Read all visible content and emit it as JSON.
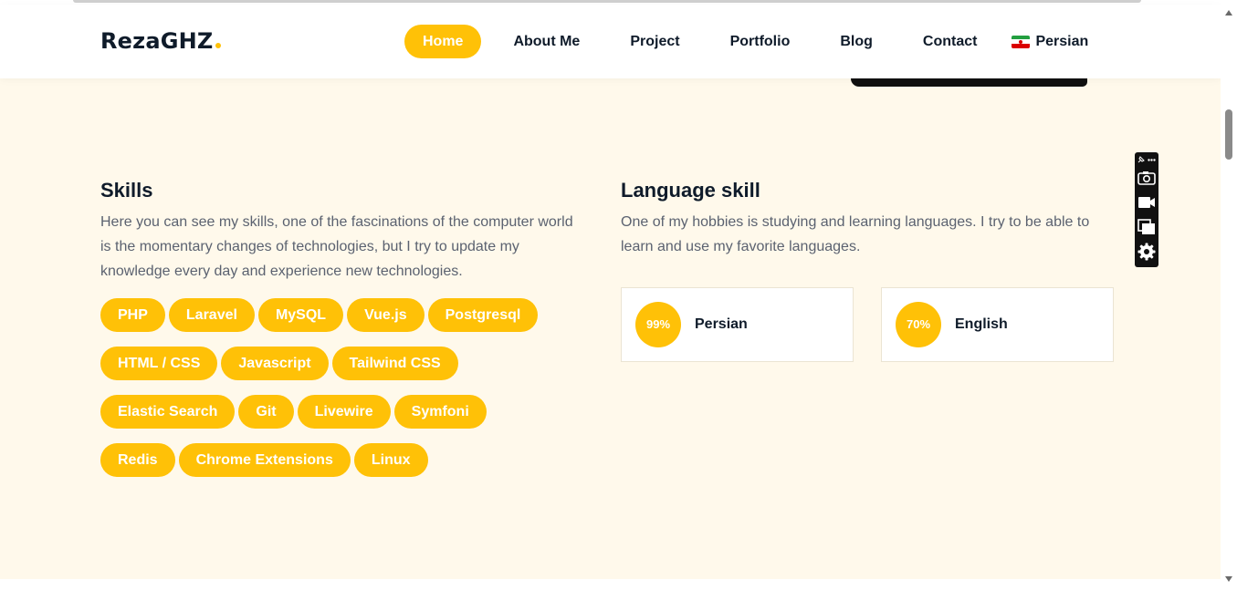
{
  "header": {
    "logo_text": "RezaGHZ",
    "nav": [
      {
        "label": "Home",
        "active": true
      },
      {
        "label": "About Me"
      },
      {
        "label": "Project"
      },
      {
        "label": "Portfolio"
      },
      {
        "label": "Blog"
      },
      {
        "label": "Contact"
      }
    ],
    "language_switch": {
      "label": "Persian",
      "flag": "iran-flag-icon"
    }
  },
  "skills": {
    "title": "Skills",
    "description": "Here you can see my skills, one of the fascinations of the computer world is the momentary changes of technologies, but I try to update my knowledge every day and experience new technologies.",
    "tags": [
      "PHP",
      "Laravel",
      "MySQL",
      "Vue.js",
      "Postgresql",
      "HTML / CSS",
      "Javascript",
      "Tailwind CSS",
      "Elastic Search",
      "Git",
      "Livewire",
      "Symfoni",
      "Redis",
      "Chrome Extensions",
      "Linux"
    ]
  },
  "language_skill": {
    "title": "Language skill",
    "description": "One of my hobbies is studying and learning languages. I try to be able to learn and use my favorite languages.",
    "languages": [
      {
        "percent": "99%",
        "name": "Persian"
      },
      {
        "percent": "70%",
        "name": "English"
      }
    ]
  },
  "float_toolbar": {
    "icons": [
      "pin-icon",
      "more-icon",
      "camera-icon",
      "video-icon",
      "copy-icon",
      "settings-icon"
    ]
  },
  "colors": {
    "accent": "#ffc107",
    "section_bg": "#fff9eb",
    "text_dark": "#0f1b2a",
    "text_muted": "#5b6270"
  }
}
